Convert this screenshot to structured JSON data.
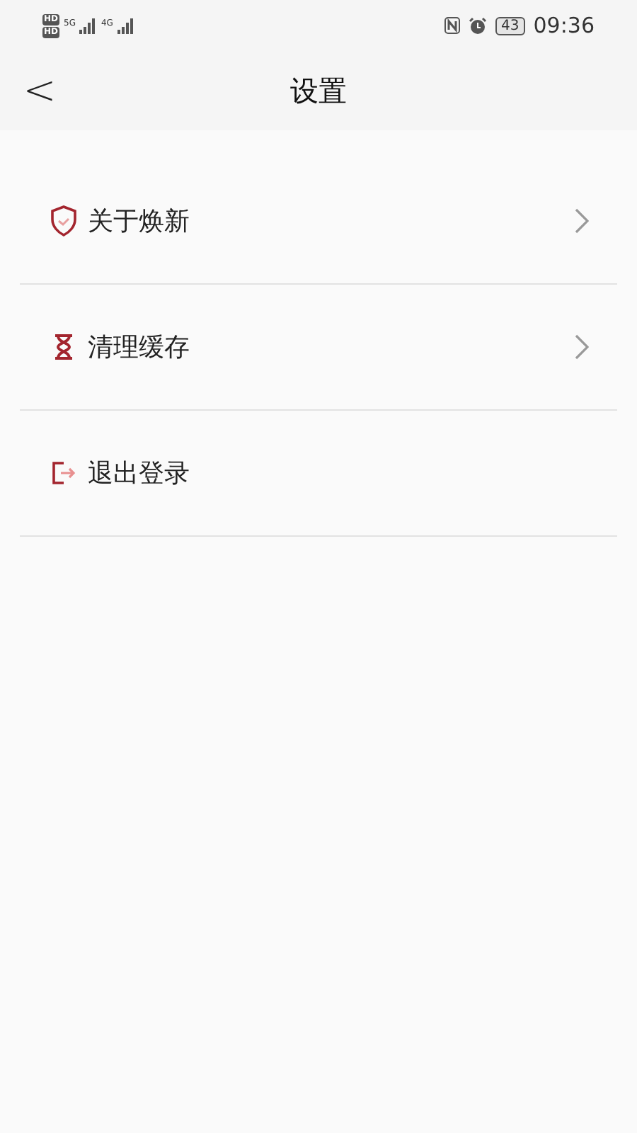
{
  "status_bar": {
    "sim_labels": [
      "HD",
      "HD"
    ],
    "network_labels": [
      "5G",
      "4G"
    ],
    "battery": "43",
    "time": "09:36"
  },
  "header": {
    "back": "<",
    "title": "设置"
  },
  "items": [
    {
      "kind": "shield",
      "label": "关于焕新",
      "has_arrow": true
    },
    {
      "kind": "hourglass",
      "label": "清理缓存",
      "has_arrow": true
    },
    {
      "kind": "exit",
      "label": "退出登录",
      "has_arrow": false
    }
  ]
}
